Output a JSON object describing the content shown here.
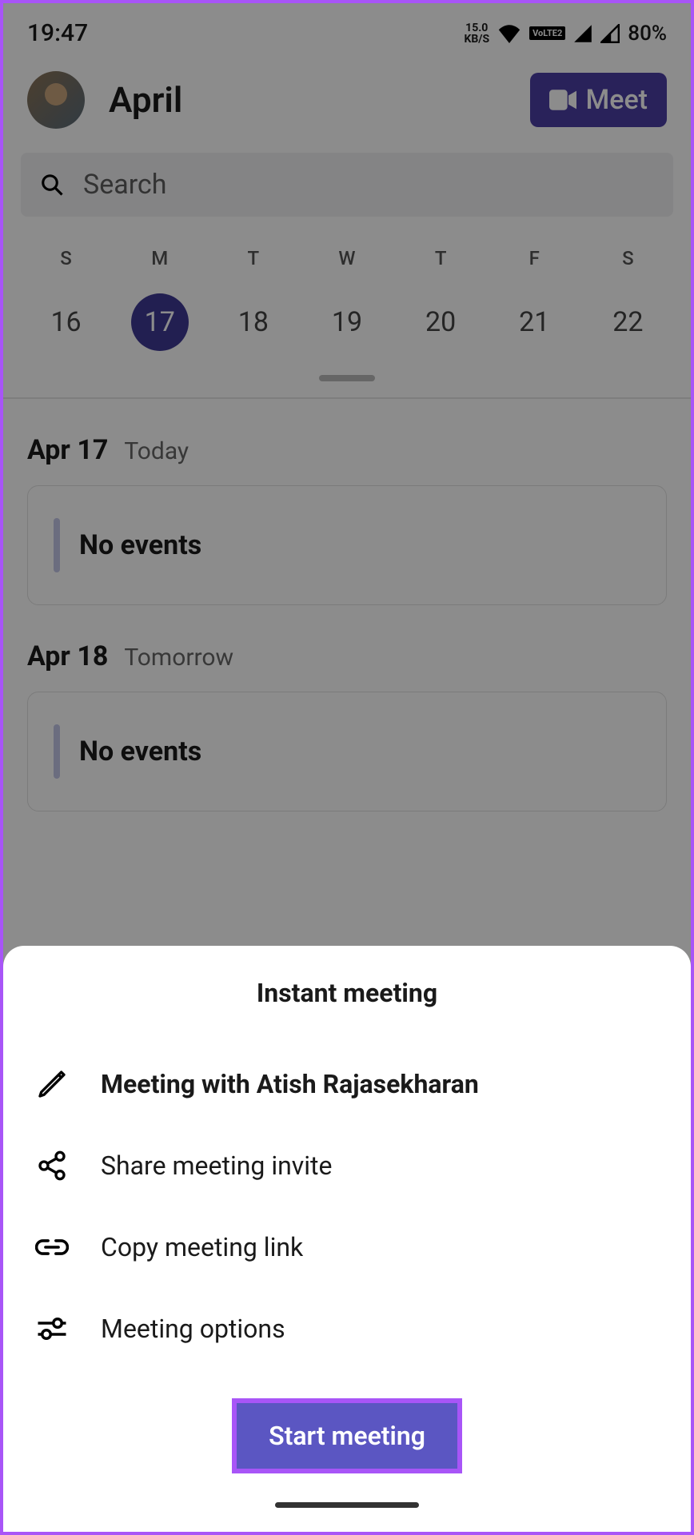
{
  "status": {
    "time": "19:47",
    "kbs_top": "15.0",
    "kbs_bottom": "KB/S",
    "volte": "VoLTE2",
    "battery": "80%"
  },
  "header": {
    "month": "April",
    "meet_label": "Meet"
  },
  "search": {
    "placeholder": "Search"
  },
  "week": {
    "days": [
      "S",
      "M",
      "T",
      "W",
      "T",
      "F",
      "S"
    ],
    "dates": [
      "16",
      "17",
      "18",
      "19",
      "20",
      "21",
      "22"
    ],
    "selected_index": 1
  },
  "events": [
    {
      "date": "Apr 17",
      "label": "Today",
      "content": "No events"
    },
    {
      "date": "Apr 18",
      "label": "Tomorrow",
      "content": "No events"
    }
  ],
  "sheet": {
    "title": "Instant meeting",
    "items": [
      {
        "icon": "pencil",
        "label": "Meeting with Atish Rajasekharan",
        "bold": true
      },
      {
        "icon": "share",
        "label": "Share meeting invite",
        "bold": false
      },
      {
        "icon": "link",
        "label": "Copy meeting link",
        "bold": false
      },
      {
        "icon": "sliders",
        "label": "Meeting options",
        "bold": false
      }
    ],
    "start_label": "Start meeting"
  }
}
